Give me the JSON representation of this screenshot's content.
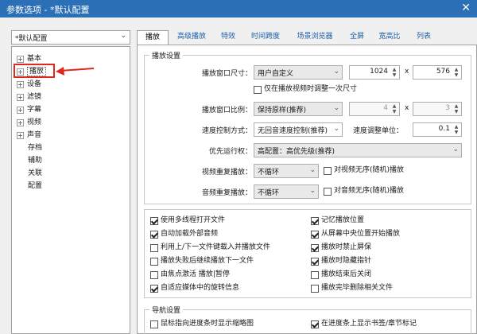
{
  "window": {
    "title": "参数选项 - *默认配置",
    "close_glyph": "✕"
  },
  "preset": {
    "value": "*默认配置"
  },
  "tree": {
    "items": [
      {
        "label": "基本",
        "expand": "+"
      },
      {
        "label": "播放",
        "expand": "+",
        "selected": true
      },
      {
        "label": "设备",
        "expand": "+"
      },
      {
        "label": "滤镜",
        "expand": "+"
      },
      {
        "label": "字幕",
        "expand": "+"
      },
      {
        "label": "视频",
        "expand": "+"
      },
      {
        "label": "声音",
        "expand": "+"
      },
      {
        "label": "存档"
      },
      {
        "label": "辅助"
      },
      {
        "label": "关联"
      },
      {
        "label": "配置"
      }
    ]
  },
  "tabs": [
    "播放",
    "高级播放",
    "特效",
    "时间跨度",
    "场景浏览器",
    "全屏",
    "宽高比",
    "列表"
  ],
  "playback": {
    "group_title": "播放设置",
    "window_size_label": "播放窗口尺寸：",
    "window_size_value": "用户自定义",
    "width": "1024",
    "times": "x",
    "height": "576",
    "resize_only_on_start": "仅在播放视频时调整一次尺寸",
    "ratio_label": "播放窗口比例：",
    "ratio_value": "保持原样(推荐)",
    "ratio_w": "4",
    "ratio_h": "3",
    "speed_label": "速度控制方式：",
    "speed_value": "无回音速度控制(推荐)",
    "speed_unit_label": "速度调整单位：",
    "speed_unit": "0.1",
    "priority_label": "优先运行权：",
    "priority_value": "高配置：高优先级(推荐)",
    "video_repeat_label": "视频重复播放：",
    "video_repeat_value": "不循环",
    "video_random": "对视频无序(随机)播放",
    "audio_repeat_label": "音频重复播放：",
    "audio_repeat_value": "不循环",
    "audio_random": "对音频无序(随机)播放"
  },
  "options_left": [
    {
      "label": "使用多线程打开文件",
      "checked": true
    },
    {
      "label": "自动加载外部音频",
      "checked": true
    },
    {
      "label": "利用上/下一文件键载入并播放文件",
      "checked": false
    },
    {
      "label": "播放失败后继续播放下一文件",
      "checked": false
    },
    {
      "label": "由焦点激活 播放|暂停",
      "checked": false
    },
    {
      "label": "自适应媒体中的旋转信息",
      "checked": true
    }
  ],
  "options_right": [
    {
      "label": "记忆播放位置",
      "checked": true
    },
    {
      "label": "从屏幕中央位置开始播放",
      "checked": true
    },
    {
      "label": "播放时禁止屏保",
      "checked": true
    },
    {
      "label": "播放时隐藏指针",
      "checked": true
    },
    {
      "label": "播放结束后关闭",
      "checked": false
    },
    {
      "label": "播放完毕删除相关文件",
      "checked": false
    }
  ],
  "nav": {
    "group_title": "导航设置",
    "left": {
      "label": "鼠标指向进度条时显示缩略图",
      "checked": false
    },
    "right": {
      "label": "在进度条上显示书签/章节标记",
      "checked": true
    }
  },
  "icons": [
    "expand-box-icon",
    "dropdown-caret-icon",
    "spin-up-icon",
    "spin-down-icon",
    "checkmark-icon",
    "close-icon",
    "red-arrow-icon"
  ],
  "colors": {
    "titlebar": "#2b6fb6",
    "highlight": "#e0281e",
    "tab_link": "#1c5fa8"
  }
}
